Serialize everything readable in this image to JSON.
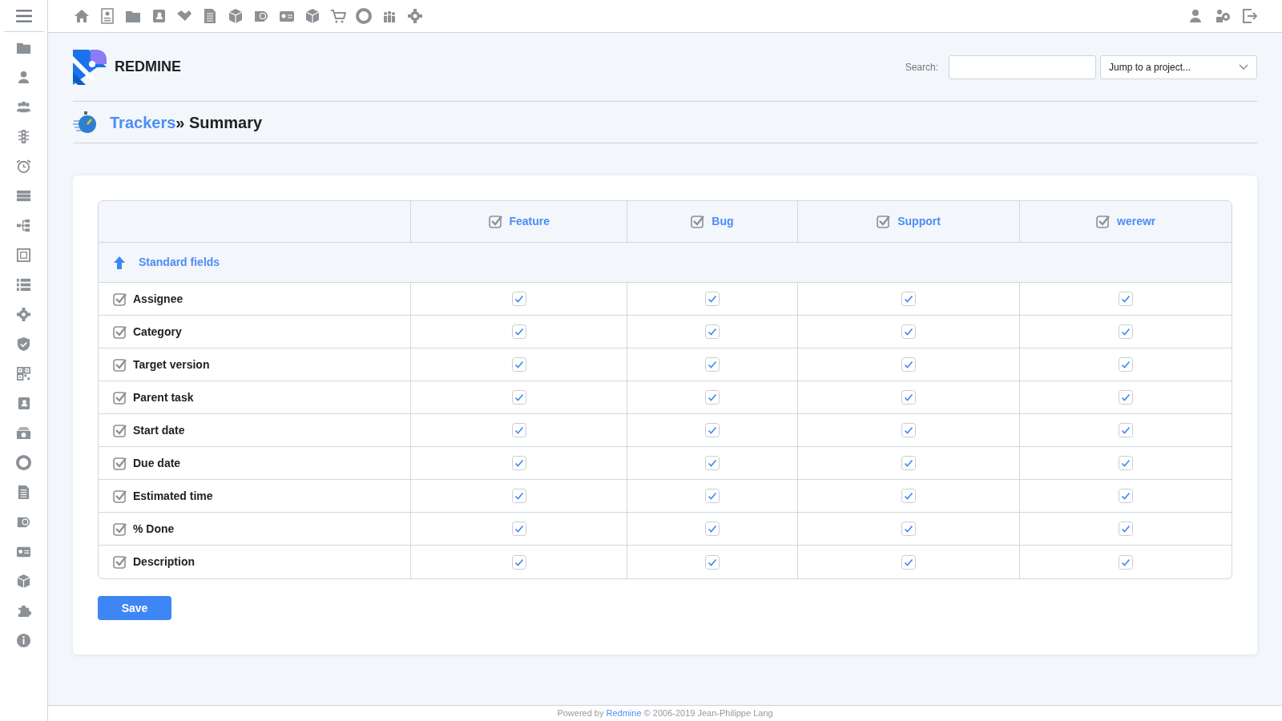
{
  "header": {
    "logo_text": "REDMINE",
    "search_label": "Search:",
    "project_jump": {
      "placeholder": "Jump to a project..."
    }
  },
  "breadcrumb": {
    "link": "Trackers",
    "separator": "»",
    "title": "Summary"
  },
  "table": {
    "trackers": [
      {
        "label": "Feature",
        "checked": true
      },
      {
        "label": "Bug",
        "checked": true
      },
      {
        "label": "Support",
        "checked": true
      },
      {
        "label": "werewr",
        "checked": true
      }
    ],
    "section": {
      "label": "Standard fields",
      "expanded": true
    },
    "rows": [
      {
        "label": "Assignee",
        "checked": true,
        "values": [
          true,
          true,
          true,
          true
        ]
      },
      {
        "label": "Category",
        "checked": true,
        "values": [
          true,
          true,
          true,
          true
        ]
      },
      {
        "label": "Target version",
        "checked": true,
        "values": [
          true,
          true,
          true,
          true
        ]
      },
      {
        "label": "Parent task",
        "checked": true,
        "values": [
          true,
          true,
          true,
          true
        ]
      },
      {
        "label": "Start date",
        "checked": true,
        "values": [
          true,
          true,
          true,
          true
        ]
      },
      {
        "label": "Due date",
        "checked": true,
        "values": [
          true,
          true,
          true,
          true
        ]
      },
      {
        "label": "Estimated time",
        "checked": true,
        "values": [
          true,
          true,
          true,
          true
        ]
      },
      {
        "label": "% Done",
        "checked": true,
        "values": [
          true,
          true,
          true,
          true
        ]
      },
      {
        "label": "Description",
        "checked": true,
        "values": [
          true,
          true,
          true,
          true
        ]
      }
    ]
  },
  "save_button": "Save",
  "footer": {
    "prefix": "Powered by",
    "link": "Redmine",
    "suffix": "© 2006-2019 Jean-Philippe Lang"
  }
}
